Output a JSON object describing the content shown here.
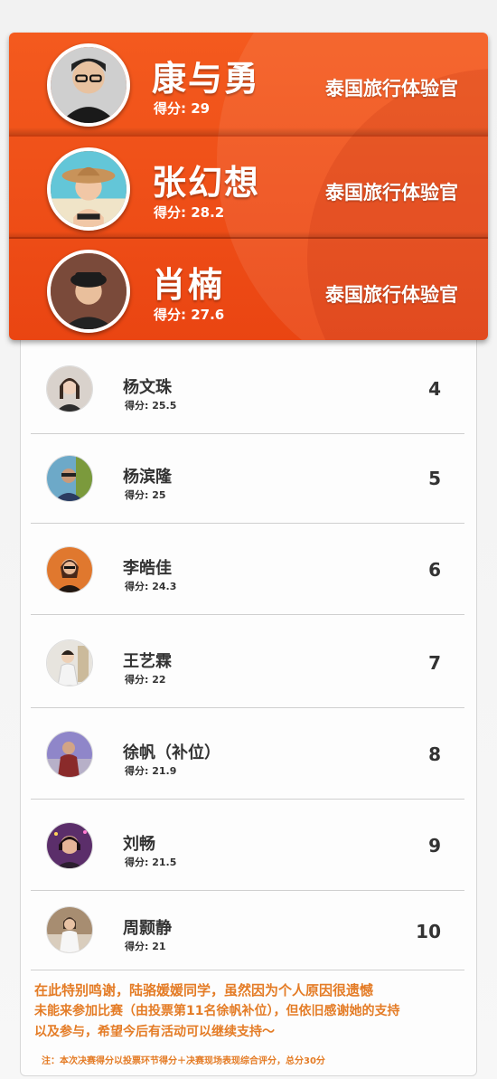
{
  "top": [
    {
      "name": "康与勇",
      "score_label": "得分:",
      "score": "29",
      "title": "泰国旅行体验官",
      "avatar": "avatar-portrait-man-glasses"
    },
    {
      "name": "张幻想",
      "score_label": "得分:",
      "score": "28.2",
      "title": "泰国旅行体验官",
      "avatar": "avatar-portrait-woman-hat"
    },
    {
      "name": "肖楠",
      "score_label": "得分:",
      "score": "27.6",
      "title": "泰国旅行体验官",
      "avatar": "avatar-portrait-woman-cap"
    }
  ],
  "list": [
    {
      "name": "杨文珠",
      "score_label": "得分:",
      "score": "25.5",
      "rank": "4"
    },
    {
      "name": "杨滨隆",
      "score_label": "得分:",
      "score": "25",
      "rank": "5"
    },
    {
      "name": "李皓佳",
      "score_label": "得分:",
      "score": "24.3",
      "rank": "6"
    },
    {
      "name": "王艺霖",
      "score_label": "得分:",
      "score": "22",
      "rank": "7"
    },
    {
      "name": "徐帆（补位）",
      "score_label": "得分:",
      "score": "21.9",
      "rank": "8"
    },
    {
      "name": "刘畅",
      "score_label": "得分:",
      "score": "21.5",
      "rank": "9"
    },
    {
      "name": "周颢静",
      "score_label": "得分:",
      "score": "21",
      "rank": "10"
    }
  ],
  "footer": {
    "line1": "在此特别鸣谢，陆骆媛媛同学，虽然因为个人原因很遗憾",
    "line2": "未能来参加比赛（由投票第11名徐帆补位），但依旧感谢她的支持",
    "line3": "以及参与，希望今后有活动可以继续支持～",
    "note": "注：本次决赛得分以投票环节得分＋决赛现场表现综合评分，总分30分"
  },
  "colors": {
    "accent": "#f0501a",
    "footer_text": "#e47c26"
  }
}
